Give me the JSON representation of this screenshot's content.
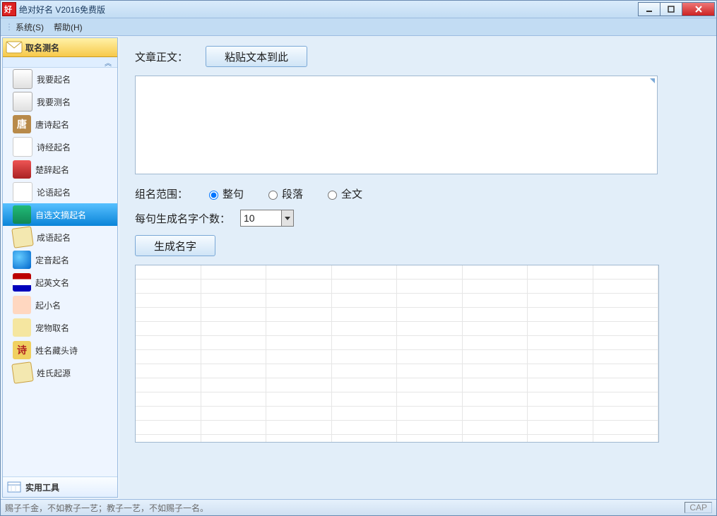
{
  "window": {
    "title": "绝对好名 V2016免费版"
  },
  "menubar": {
    "system": "系统(S)",
    "help": "帮助(H)"
  },
  "sidebar": {
    "header_title": "取名测名",
    "collapse_glyph": "︽",
    "footer_title": "实用工具",
    "items": [
      {
        "label": "我要起名",
        "icon": "person"
      },
      {
        "label": "我要测名",
        "icon": "magnify"
      },
      {
        "label": "唐诗起名",
        "icon": "tang"
      },
      {
        "label": "诗经起名",
        "icon": "list"
      },
      {
        "label": "楚辞起名",
        "icon": "red"
      },
      {
        "label": "论语起名",
        "icon": "list"
      },
      {
        "label": "自选文摘起名",
        "icon": "book",
        "selected": true
      },
      {
        "label": "成语起名",
        "icon": "scroll"
      },
      {
        "label": "定音起名",
        "icon": "sound"
      },
      {
        "label": "起英文名",
        "icon": "flag"
      },
      {
        "label": "起小名",
        "icon": "baby"
      },
      {
        "label": "宠物取名",
        "icon": "dog"
      },
      {
        "label": "姓名藏头诗",
        "icon": "poem"
      },
      {
        "label": "姓氏起源",
        "icon": "scroll"
      }
    ]
  },
  "main": {
    "article_label": "文章正文：",
    "paste_button": "粘贴文本到此",
    "textarea_value": "",
    "group_scope_label": "组名范围：",
    "radios": [
      {
        "label": "整句",
        "checked": true
      },
      {
        "label": "段落",
        "checked": false
      },
      {
        "label": "全文",
        "checked": false
      }
    ],
    "per_sentence_label": "每句生成名字个数：",
    "combo_value": "10",
    "generate_button": "生成名字"
  },
  "statusbar": {
    "text": "赐子千金，不如教子一艺；教子一艺，不如赐子一名。",
    "cap": "CAP"
  }
}
